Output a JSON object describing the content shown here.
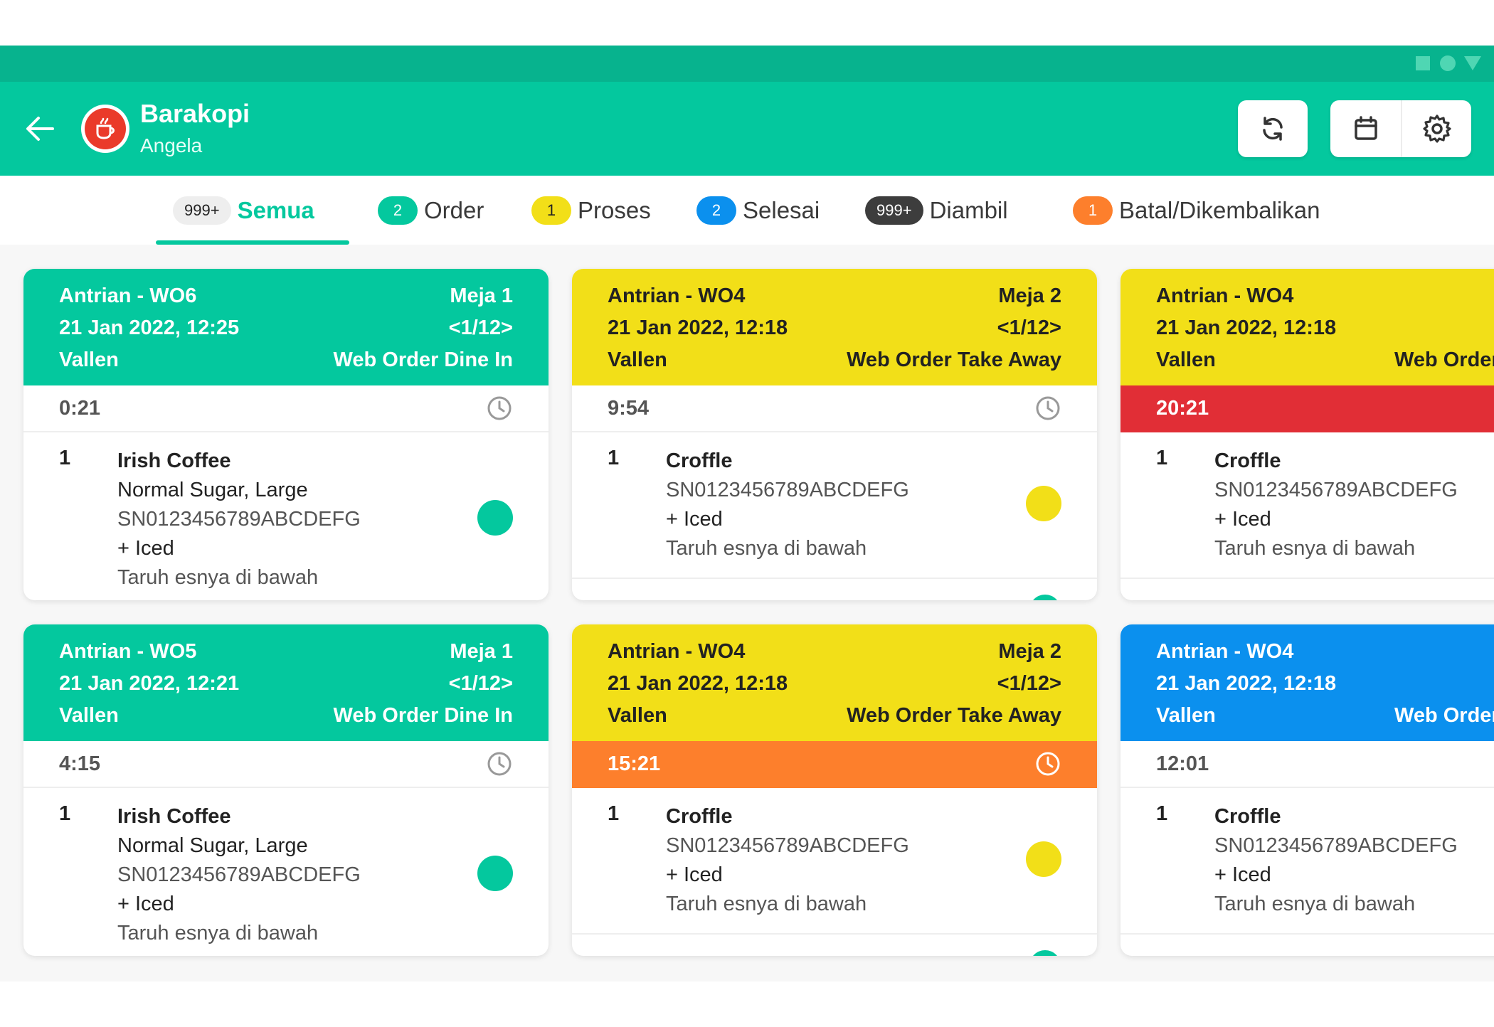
{
  "app": {
    "store_name": "Barakopi",
    "user_name": "Angela"
  },
  "colors": {
    "green": "#04c89e",
    "yellow": "#f2df18",
    "blue": "#0b90ee",
    "red": "#e12e36",
    "orange": "#fd7f2c"
  },
  "tabs": [
    {
      "badge": "999+",
      "label": "Semua"
    },
    {
      "badge": "2",
      "label": "Order"
    },
    {
      "badge": "1",
      "label": "Proses"
    },
    {
      "badge": "2",
      "label": "Selesai"
    },
    {
      "badge": "999+",
      "label": "Diambil"
    },
    {
      "badge": "1",
      "label": "Batal/Dikembalikan"
    }
  ],
  "cards": [
    {
      "queue": "Antrian - WO6",
      "table": "Meja 1",
      "datetime": "21 Jan 2022, 12:25",
      "page": "<1/12>",
      "customer": "Vallen",
      "type": "Web Order Dine In",
      "timer": "0:21",
      "item": {
        "qty": "1",
        "name": "Irish Coffee",
        "variant": "Normal Sugar, Large",
        "sn": "SN0123456789ABCDEFG",
        "addon": "+ Iced",
        "note": "Taruh esnya di bawah"
      }
    },
    {
      "queue": "Antrian - WO4",
      "table": "Meja 2",
      "datetime": "21 Jan 2022, 12:18",
      "page": "<1/12>",
      "customer": "Vallen",
      "type": "Web Order Take Away",
      "timer": "9:54",
      "item": {
        "qty": "1",
        "name": "Croffle",
        "sn": "SN0123456789ABCDEFG",
        "addon": "+ Iced",
        "note": "Taruh esnya di bawah"
      }
    },
    {
      "queue": "Antrian - WO4",
      "table": "",
      "datetime": "21 Jan 2022, 12:18",
      "page": "",
      "customer": "Vallen",
      "type": "Web Order",
      "timer": "20:21",
      "item": {
        "qty": "1",
        "name": "Croffle",
        "sn": "SN0123456789ABCDEFG",
        "addon": "+ Iced",
        "note": "Taruh esnya di bawah"
      }
    },
    {
      "queue": "Antrian - WO5",
      "table": "Meja 1",
      "datetime": "21 Jan 2022, 12:21",
      "page": "<1/12>",
      "customer": "Vallen",
      "type": "Web Order Dine In",
      "timer": "4:15",
      "item": {
        "qty": "1",
        "name": "Irish Coffee",
        "variant": "Normal Sugar, Large",
        "sn": "SN0123456789ABCDEFG",
        "addon": "+ Iced",
        "note": "Taruh esnya di bawah"
      }
    },
    {
      "queue": "Antrian - WO4",
      "table": "Meja 2",
      "datetime": "21 Jan 2022, 12:18",
      "page": "<1/12>",
      "customer": "Vallen",
      "type": "Web Order Take Away",
      "timer": "15:21",
      "item": {
        "qty": "1",
        "name": "Croffle",
        "sn": "SN0123456789ABCDEFG",
        "addon": "+ Iced",
        "note": "Taruh esnya di bawah"
      }
    },
    {
      "queue": "Antrian - WO4",
      "table": "",
      "datetime": "21 Jan 2022, 12:18",
      "page": "",
      "customer": "Vallen",
      "type": "Web Order",
      "timer": "12:01",
      "item": {
        "qty": "1",
        "name": "Croffle",
        "sn": "SN0123456789ABCDEFG",
        "addon": "+ Iced",
        "note": "Taruh esnya di bawah"
      }
    }
  ]
}
